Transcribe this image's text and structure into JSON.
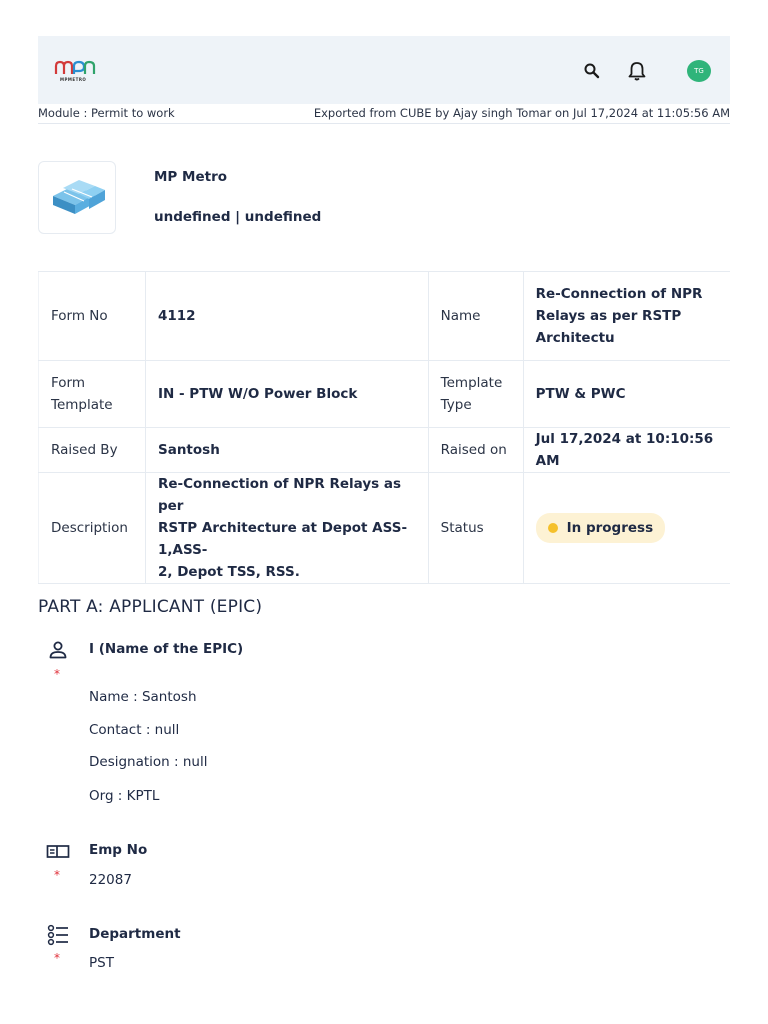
{
  "header": {
    "logo_text": "MPMETRO",
    "avatar_initials": "TG",
    "icons": [
      "search-icon",
      "bell-icon"
    ],
    "avatar_color": "#2fb47a"
  },
  "meta": {
    "module": "Module : Permit to work",
    "exported": "Exported from CUBE by Ajay singh Tomar on Jul 17,2024 at 11:05:56 AM"
  },
  "org": {
    "name": "MP Metro",
    "subtitle": "undefined | undefined"
  },
  "info_table": {
    "rows": [
      {
        "label1": "Form No",
        "value1": "4112",
        "label2": "Name",
        "value2_lines": [
          "Re-Connection of NPR",
          "Relays as per RSTP",
          "Architectu"
        ]
      },
      {
        "label1_lines": [
          "Form",
          "Template"
        ],
        "value1": "IN - PTW W/O Power Block",
        "label2_lines": [
          "Template",
          "Type"
        ],
        "value2": "PTW & PWC"
      },
      {
        "label1": "Raised By",
        "value1": "Santosh",
        "label2": "Raised on",
        "value2": "Jul 17,2024 at 10:10:56 AM"
      },
      {
        "label1": "Description",
        "value1_lines": [
          "Re-Connection of NPR Relays as per",
          "RSTP Architecture at Depot ASS-1,ASS-",
          "2, Depot TSS, RSS."
        ],
        "label2": "Status",
        "value2": "In progress"
      }
    ],
    "status_color": "#f5c02a",
    "status_bg": "#fdf2d4"
  },
  "part_a": {
    "title": "PART A: APPLICANT (EPIC)",
    "required_mark": "*",
    "fields": [
      {
        "icon": "person-icon",
        "title": "I (Name of the EPIC)",
        "lines": [
          "Name : Santosh",
          "Contact : null",
          "Designation : null",
          "Org : KPTL"
        ]
      },
      {
        "icon": "id-card-icon",
        "title": "Emp No",
        "lines": [
          "22087"
        ]
      },
      {
        "icon": "list-icon",
        "title": "Department",
        "lines": [
          "PST"
        ]
      }
    ]
  }
}
